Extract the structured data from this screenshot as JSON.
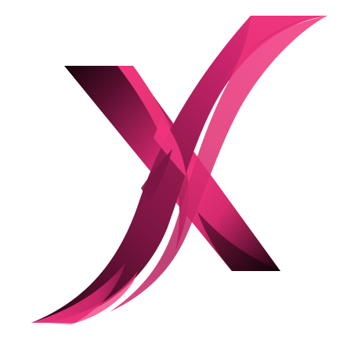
{
  "logo": {
    "icon": "x-letter-logo-icon",
    "colors": {
      "hot_pink": "#F0357D",
      "magenta": "#D6286E",
      "berry": "#8E1A4C",
      "dark_wine": "#3A0A1F",
      "near_black": "#140309",
      "background": "#FFFFFF"
    }
  }
}
